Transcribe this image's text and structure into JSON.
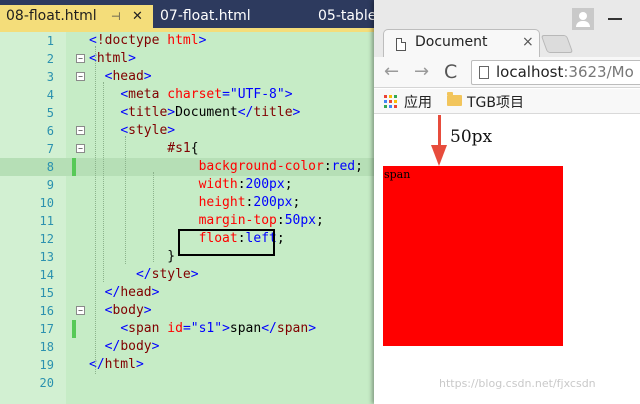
{
  "editor": {
    "tabs": [
      {
        "label": "08-float.html",
        "pin": "⊣",
        "close": "✕"
      },
      {
        "label": "07-float.html"
      },
      {
        "label": "05-table"
      }
    ],
    "lines": [
      {
        "n": "1",
        "html": "<span class='br'>&lt;</span><span class='tag'>!doctype</span> <span class='at'>html</span><span class='br'>&gt;</span>"
      },
      {
        "n": "2",
        "fold": "−",
        "html": "<span class='br'>&lt;</span><span class='tag'>html</span><span class='br'>&gt;</span>"
      },
      {
        "n": "3",
        "fold": "−",
        "html": "  <span class='br'>&lt;</span><span class='tag'>head</span><span class='br'>&gt;</span>"
      },
      {
        "n": "4",
        "html": "    <span class='br'>&lt;</span><span class='tag'>meta</span> <span class='at'>charset</span><span class='br'>=</span><span class='val'>\"UTF-8\"</span><span class='br'>&gt;</span>"
      },
      {
        "n": "5",
        "html": "    <span class='br'>&lt;</span><span class='tag'>title</span><span class='br'>&gt;</span><span class='txt'>Document</span><span class='br'>&lt;/</span><span class='tag'>title</span><span class='br'>&gt;</span>"
      },
      {
        "n": "6",
        "fold": "−",
        "html": "    <span class='br'>&lt;</span><span class='tag'>style</span><span class='br'>&gt;</span>"
      },
      {
        "n": "7",
        "fold": "−",
        "html": "          <span class='sel'>#s1</span><span class='txt'>{</span>"
      },
      {
        "n": "8",
        "mark": true,
        "cur": true,
        "html": "              <span class='prop'>background-color</span><span class='txt'>:</span><span class='pv'>red</span><span class='txt'>;</span>"
      },
      {
        "n": "9",
        "html": "              <span class='prop'>width</span><span class='txt'>:</span><span class='pv'>200px</span><span class='txt'>;</span>"
      },
      {
        "n": "10",
        "html": "              <span class='prop'>height</span><span class='txt'>:</span><span class='pv'>200px</span><span class='txt'>;</span>"
      },
      {
        "n": "11",
        "html": "              <span class='prop'>margin-top</span><span class='txt'>:</span><span class='pv'>50px</span><span class='txt'>;</span>"
      },
      {
        "n": "12",
        "html": "              <span class='prop'>float</span><span class='txt'>:</span><span class='pv'>left</span><span class='txt'>;</span>"
      },
      {
        "n": "13",
        "html": "          <span class='txt'>}</span>"
      },
      {
        "n": "14",
        "html": "      <span class='br'>&lt;/</span><span class='tag'>style</span><span class='br'>&gt;</span>"
      },
      {
        "n": "15",
        "html": "  <span class='br'>&lt;/</span><span class='tag'>head</span><span class='br'>&gt;</span>"
      },
      {
        "n": "16",
        "fold": "−",
        "html": "  <span class='br'>&lt;</span><span class='tag'>body</span><span class='br'>&gt;</span>"
      },
      {
        "n": "17",
        "mark": true,
        "html": "    <span class='br'>&lt;</span><span class='tag'>span</span> <span class='at'>id</span><span class='br'>=</span><span class='val'>\"s1\"</span><span class='br'>&gt;</span><span class='txt'>span</span><span class='br'>&lt;/</span><span class='tag'>span</span><span class='br'>&gt;</span>"
      },
      {
        "n": "18",
        "html": "  <span class='br'>&lt;/</span><span class='tag'>body</span><span class='br'>&gt;</span>"
      },
      {
        "n": "19",
        "html": "<span class='br'>&lt;/</span><span class='tag'>html</span><span class='br'>&gt;</span>"
      },
      {
        "n": "20",
        "html": ""
      }
    ]
  },
  "browser": {
    "tab_title": "Document",
    "tab_close": "×",
    "url_host": "localhost",
    "url_rest": ":3623/Mo",
    "nav_back": "←",
    "nav_forward": "→",
    "nav_reload": "C",
    "bookmarks": {
      "apps": "应用",
      "folder": "TGB项目"
    },
    "page": {
      "span_text": "span",
      "annotation": "50px",
      "box_color": "#ff0000",
      "arrow_color": "#e74c3c"
    },
    "watermark": "https://blog.csdn.net/fjxcsdn"
  }
}
